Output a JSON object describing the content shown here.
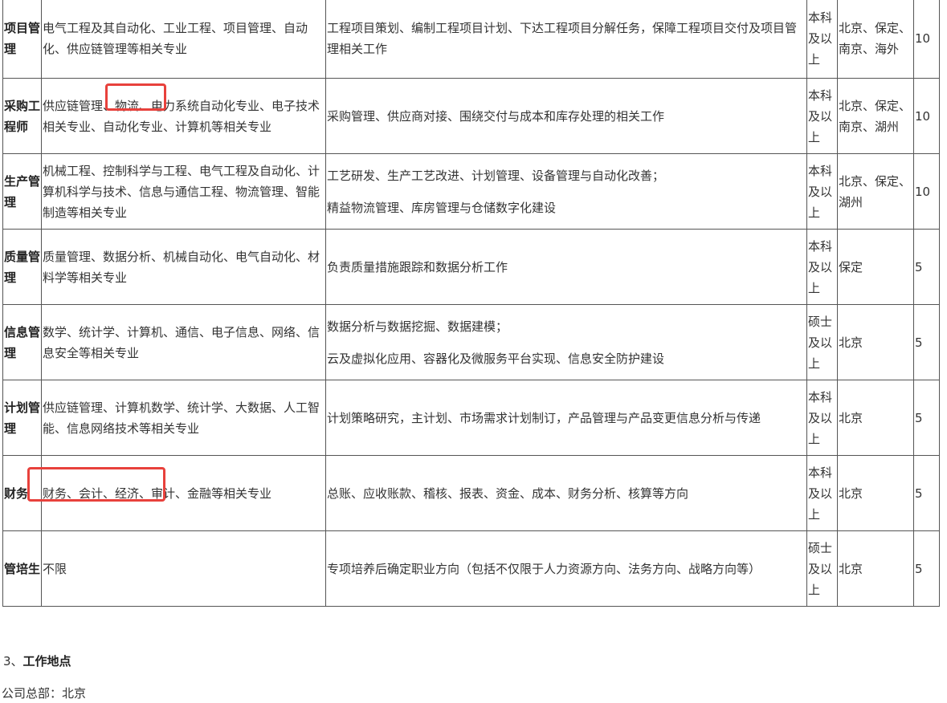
{
  "table": {
    "rows": [
      {
        "title": "项目管理",
        "majors": "电气工程及其自动化、工业工程、项目管理、自动化、供应链管理等相关专业",
        "duties": [
          "工程项目策划、编制工程项目计划、下达工程项目分解任务，保障工程项目交付及项目管理相关工作"
        ],
        "education": "本科及以上",
        "location": "北京、保定、南京、海外",
        "count": "10"
      },
      {
        "title": "采购工程师",
        "majors": "供应链管理、物流、电力系统自动化专业、电子技术相关专业、自动化专业、计算机等相关专业",
        "duties": [
          "采购管理、供应商对接、围绕交付与成本和库存处理的相关工作"
        ],
        "education": "本科及以上",
        "location": "北京、保定、南京、湖州",
        "count": "10"
      },
      {
        "title": "生产管理",
        "majors": "机械工程、控制科学与工程、电气工程及自动化、计算机科学与技术、信息与通信工程、物流管理、智能制造等相关专业",
        "duties": [
          "工艺研发、生产工艺改进、计划管理、设备管理与自动化改善；",
          "精益物流管理、库房管理与仓储数字化建设"
        ],
        "education": "本科及以上",
        "location": "北京、保定、湖州",
        "count": "10"
      },
      {
        "title": "质量管理",
        "majors": "质量管理、数据分析、机械自动化、电气自动化、材料学等相关专业",
        "duties": [
          "负责质量措施跟踪和数据分析工作"
        ],
        "education": "本科及以上",
        "location": "保定",
        "count": "5"
      },
      {
        "title": "信息管理",
        "majors": "数学、统计学、计算机、通信、电子信息、网络、信息安全等相关专业",
        "duties": [
          "数据分析与数据挖掘、数据建模；",
          "云及虚拟化应用、容器化及微服务平台实现、信息安全防护建设"
        ],
        "education": "硕士及以上",
        "location": "北京",
        "count": "5"
      },
      {
        "title": "计划管理",
        "majors": "供应链管理、计算机数学、统计学、大数据、人工智能、信息网络技术等相关专业",
        "duties": [
          "计划策略研究，主计划、市场需求计划制订，产品管理与产品变更信息分析与传递"
        ],
        "education": "本科及以上",
        "location": "北京",
        "count": "5"
      },
      {
        "title": "财务",
        "majors": "财务、会计、经济、审计、金融等相关专业",
        "duties": [
          "总账、应收账款、稽核、报表、资金、成本、财务分析、核算等方向"
        ],
        "education": "本科及以上",
        "location": "北京",
        "count": "5"
      },
      {
        "title": "管培生",
        "majors": "不限",
        "duties": [
          "专项培养后确定职业方向（包括不仅限于人力资源方向、法务方向、战略方向等）"
        ],
        "education": "硕士及以上",
        "location": "北京",
        "count": "5"
      }
    ]
  },
  "section": {
    "number": "3、",
    "heading": "工作地点",
    "hq": "公司总部：北京"
  },
  "colors": {
    "highlight": "#e8413c",
    "border": "#555555",
    "text": "#333333"
  }
}
